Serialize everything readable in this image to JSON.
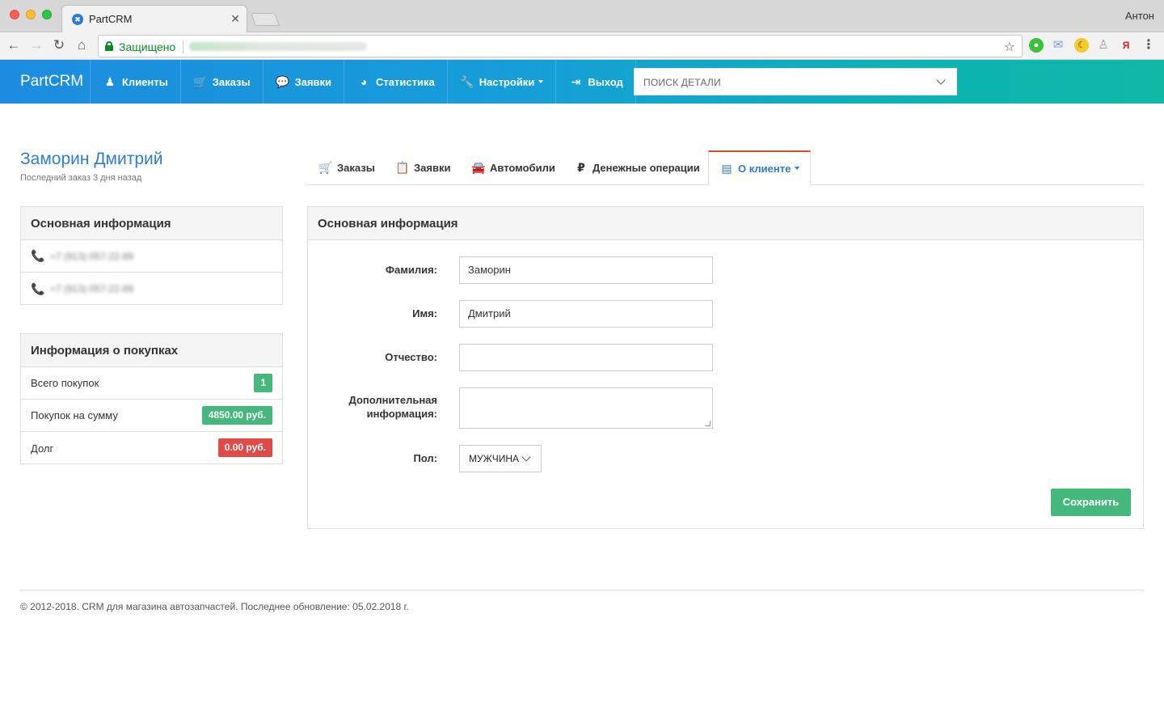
{
  "browser": {
    "tab_title": "PartCRM",
    "tab_close": "✕",
    "user_name": "Антон",
    "secure_label": "Защищено",
    "nav": {
      "back": "←",
      "forward": "→",
      "reload": "↻",
      "home": "⌂"
    },
    "star": "☆",
    "extensions": {
      "ext1": "●",
      "ext2": "✉",
      "ext3": "☾",
      "ext4": "♙",
      "ext5": "Я",
      "ext6": "⋮"
    }
  },
  "navbar": {
    "brand": "PartCRM",
    "items": [
      {
        "label": "Клиенты",
        "icon": "user-icon",
        "glyph": "♟"
      },
      {
        "label": "Заказы",
        "icon": "cart-icon",
        "glyph": "🛒"
      },
      {
        "label": "Заявки",
        "icon": "chat-icon",
        "glyph": "💬"
      },
      {
        "label": "Статистика",
        "icon": "pie-chart-icon",
        "glyph": "◕"
      },
      {
        "label": "Настройки",
        "icon": "wrench-icon",
        "glyph": "🔧"
      },
      {
        "label": "Выход",
        "icon": "logout-icon",
        "glyph": "⇥"
      }
    ],
    "search_placeholder": "ПОИСК ДЕТАЛИ"
  },
  "client": {
    "name": "Заморин Дмитрий",
    "last_order": "Последний заказ 3 дня назад"
  },
  "main_info_panel": {
    "title": "Основная информация",
    "phones": [
      "+7 (913) 057-22-89",
      "+7 (913) 057-22-89"
    ],
    "phone_icon": "phone-icon",
    "phone_glyph": "📞"
  },
  "purchases_panel": {
    "title": "Информация о покупках",
    "rows": [
      {
        "label": "Всего покупок",
        "value": "1",
        "color": "#45b97c"
      },
      {
        "label": "Покупок на сумму",
        "value": "4850.00 руб.",
        "color": "#45b97c"
      },
      {
        "label": "Долг",
        "value": "0.00 руб.",
        "color": "#e04b47"
      }
    ]
  },
  "tabs": [
    {
      "label": "Заказы",
      "icon": "cart-icon",
      "glyph": "🛒"
    },
    {
      "label": "Заявки",
      "icon": "clipboard-icon",
      "glyph": "📋"
    },
    {
      "label": "Автомобили",
      "icon": "car-icon",
      "glyph": "🚘"
    },
    {
      "label": "Денежные операции",
      "icon": "ruble-icon",
      "glyph": "₽"
    },
    {
      "label": "О клиенте",
      "icon": "contact-card-icon",
      "glyph": "▤",
      "active": true
    }
  ],
  "form": {
    "title": "Основная информация",
    "fields": {
      "last_name": {
        "label": "Фамилия:",
        "value": "Заморин"
      },
      "first_name": {
        "label": "Имя:",
        "value": "Дмитрий"
      },
      "patronymic": {
        "label": "Отчество:",
        "value": ""
      },
      "additional": {
        "label_line1": "Дополнительная",
        "label_line2": "информация:",
        "value": ""
      },
      "gender": {
        "label": "Пол:",
        "value": "МУЖЧИНА"
      }
    },
    "save_label": "Сохранить"
  },
  "footer": {
    "text": "© 2012-2018. CRM для магазина автозапчастей. Последнее обновление: 05.02.2018 г."
  },
  "colors": {
    "accent_blue": "#2f7dc9",
    "navbar_gradient_start": "#1d8ce0",
    "navbar_gradient_end": "#10b8a6",
    "success": "#45b97c",
    "danger": "#e04b47",
    "active_tab_top": "#d84a36"
  }
}
